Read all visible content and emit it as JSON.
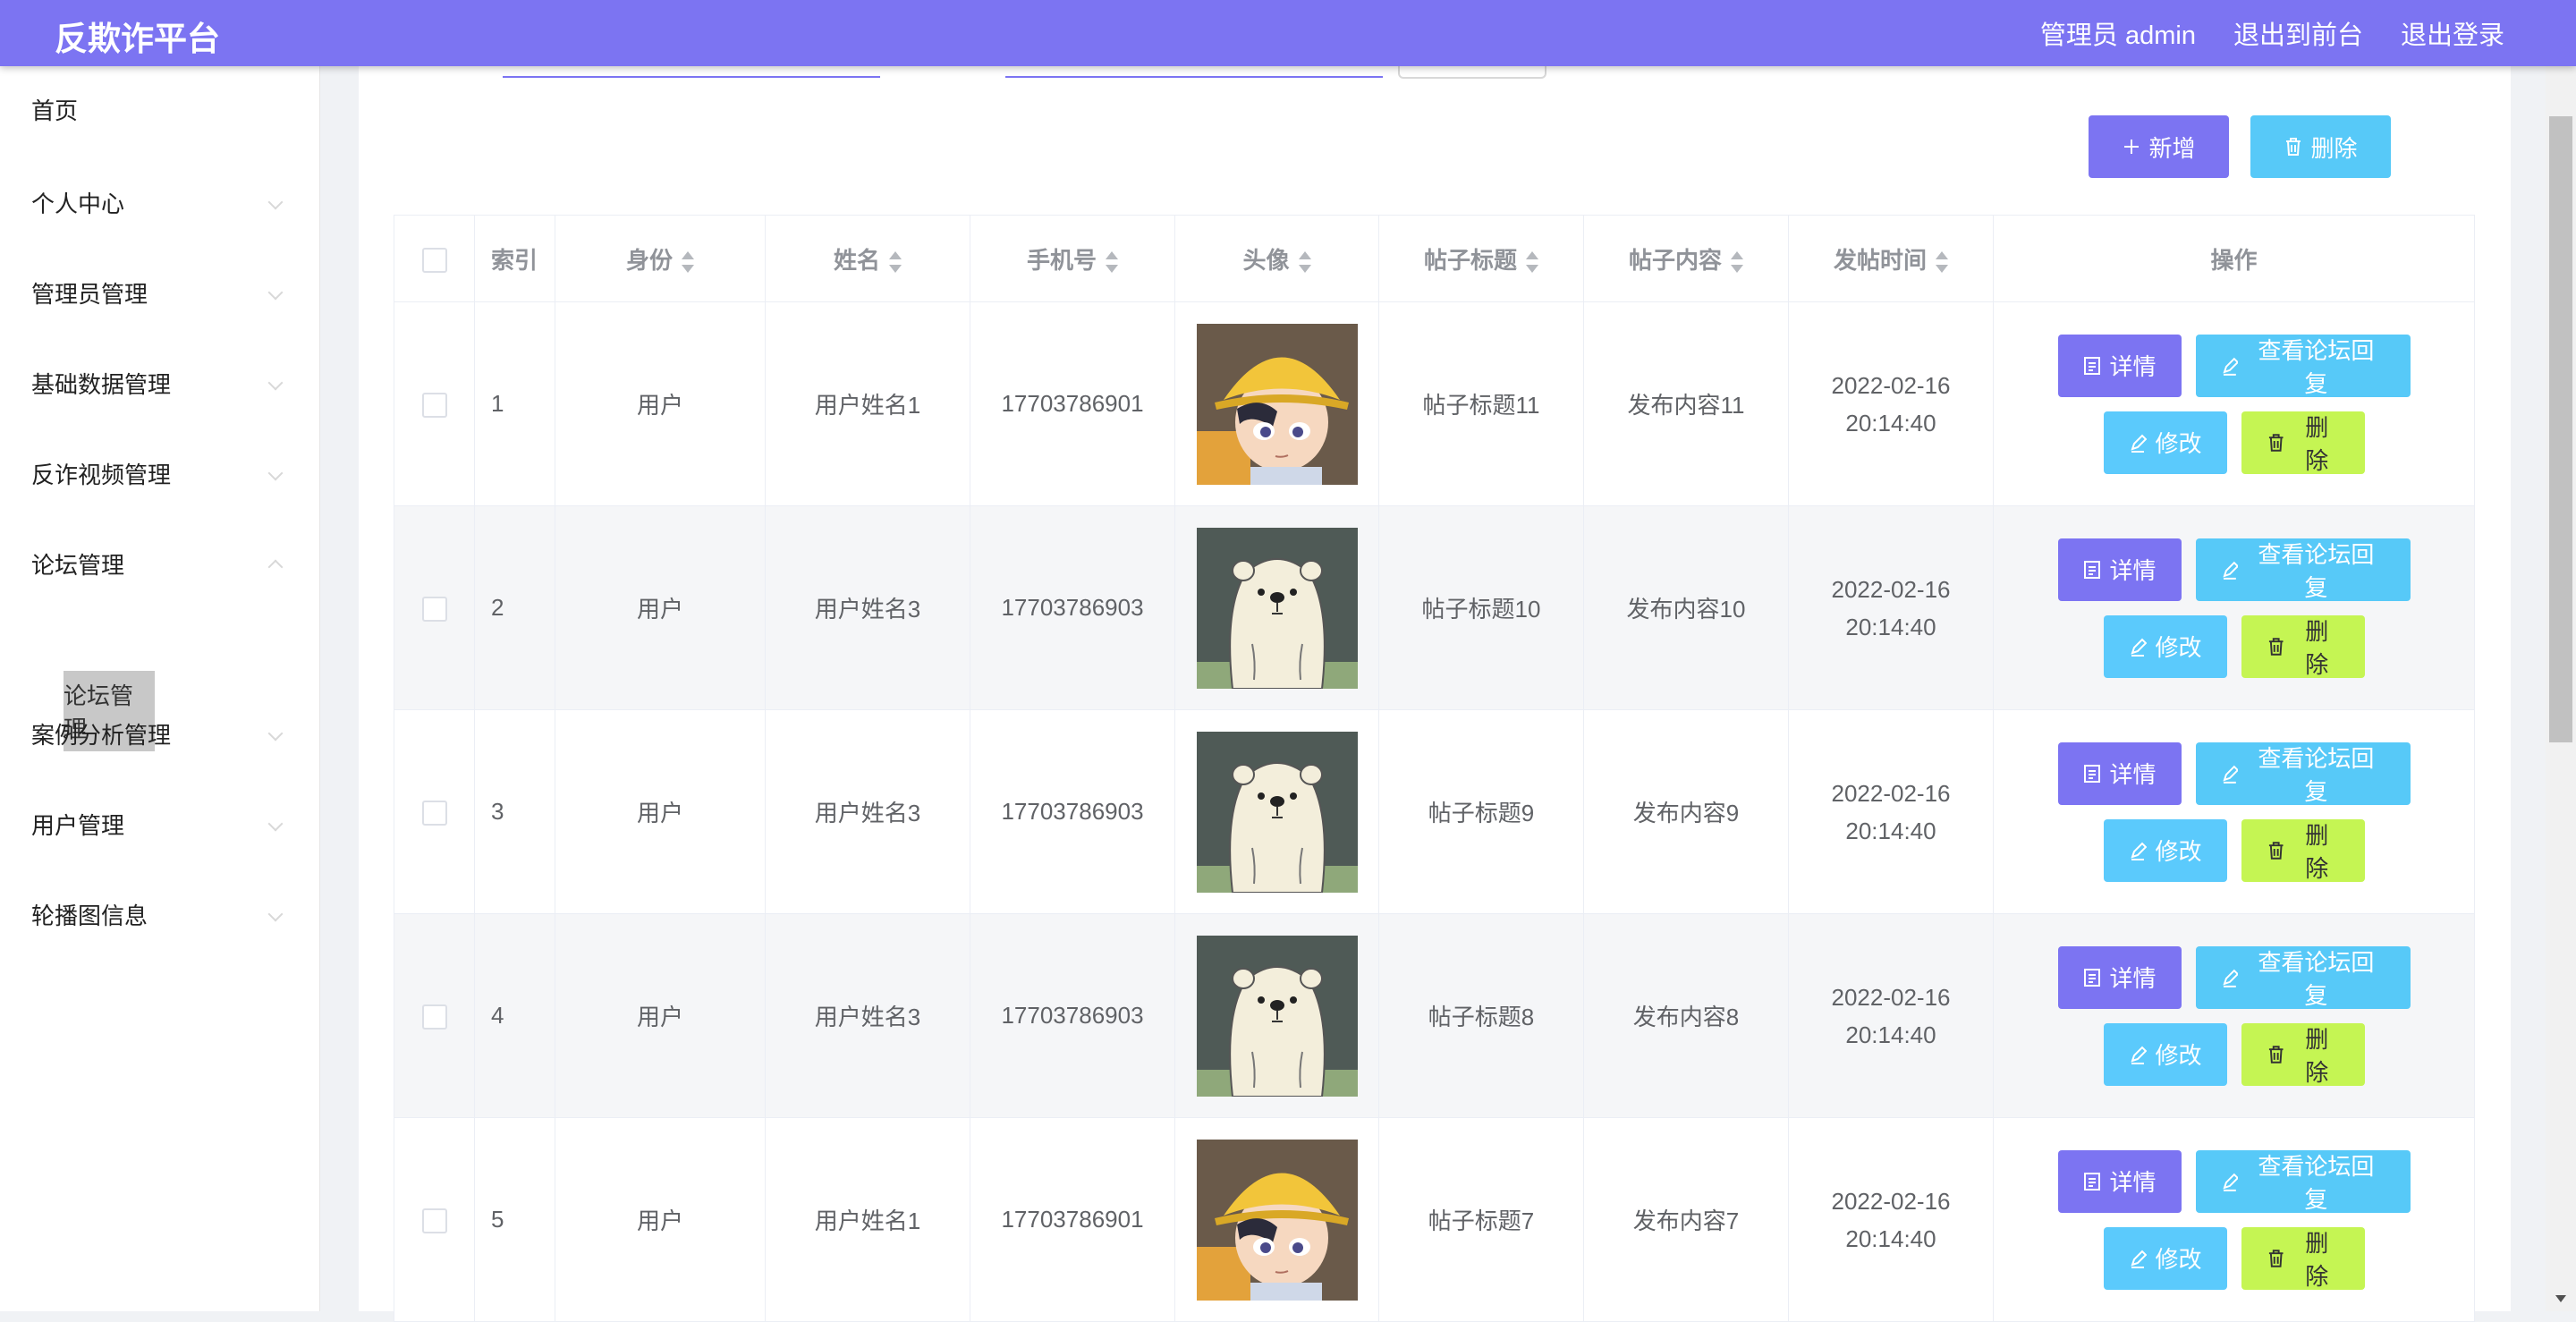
{
  "header": {
    "brand": "反欺诈平台",
    "admin_label": "管理员 admin",
    "to_front": "退出到前台",
    "logout": "退出登录",
    "color": "#7c74f2"
  },
  "sidebar": {
    "items": [
      {
        "label": "首页"
      },
      {
        "label": "个人中心"
      },
      {
        "label": "管理员管理"
      },
      {
        "label": "基础数据管理"
      },
      {
        "label": "反诈视频管理"
      },
      {
        "label": "论坛管理"
      },
      {
        "label": "案例分析管理"
      },
      {
        "label": "用户管理"
      },
      {
        "label": "轮播图信息"
      }
    ],
    "active_sub": "论坛管理"
  },
  "toolbar": {
    "add_label": "新增",
    "delete_label": "删除"
  },
  "table": {
    "columns": [
      "索引",
      "身份",
      "姓名",
      "手机号",
      "头像",
      "帖子标题",
      "帖子内容",
      "发帖时间",
      "操作"
    ],
    "rows": [
      {
        "index": "1",
        "role": "用户",
        "name": "用户姓名1",
        "phone": "17703786901",
        "avatar": "boy-icon",
        "title": "帖子标题11",
        "content": "发布内容11",
        "time": "2022-02-16 20:14:40"
      },
      {
        "index": "2",
        "role": "用户",
        "name": "用户姓名3",
        "phone": "17703786903",
        "avatar": "bear-icon",
        "title": "帖子标题10",
        "content": "发布内容10",
        "time": "2022-02-16 20:14:40"
      },
      {
        "index": "3",
        "role": "用户",
        "name": "用户姓名3",
        "phone": "17703786903",
        "avatar": "bear-icon",
        "title": "帖子标题9",
        "content": "发布内容9",
        "time": "2022-02-16 20:14:40"
      },
      {
        "index": "4",
        "role": "用户",
        "name": "用户姓名3",
        "phone": "17703786903",
        "avatar": "bear-icon",
        "title": "帖子标题8",
        "content": "发布内容8",
        "time": "2022-02-16 20:14:40"
      },
      {
        "index": "5",
        "role": "用户",
        "name": "用户姓名1",
        "phone": "17703786901",
        "avatar": "boy-icon",
        "title": "帖子标题7",
        "content": "发布内容7",
        "time": "2022-02-16 20:14:40"
      }
    ],
    "actions": {
      "detail": "详情",
      "reply": "查看论坛回复",
      "edit": "修改",
      "remove": "删除"
    }
  }
}
